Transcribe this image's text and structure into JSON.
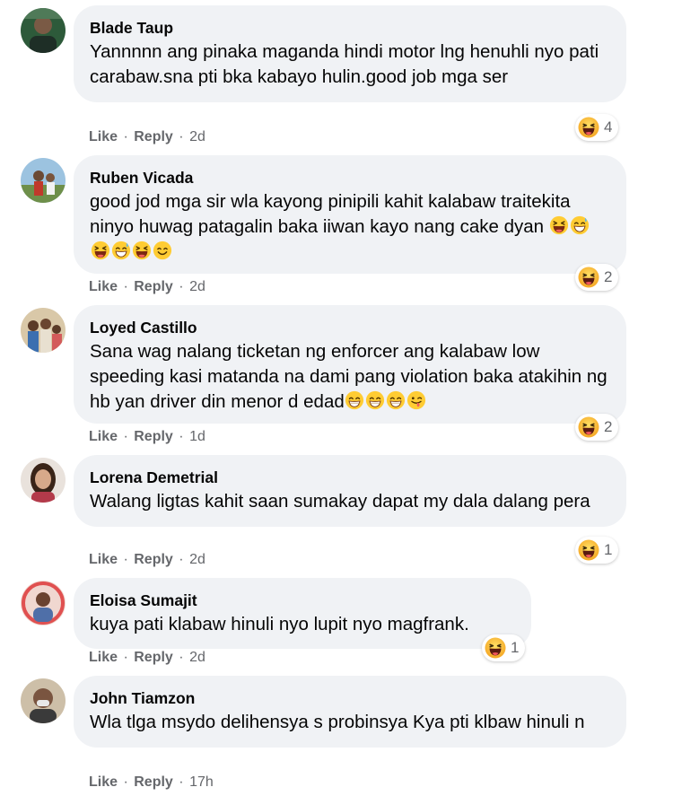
{
  "comments": [
    {
      "author": "Blade Taup",
      "text": "Yannnnn ang pinaka maganda hindi motor lng henuhli nyo pati carabaw.sna pti bka kabayo hulin.good job mga ser",
      "reaction_icon": "haha-reaction-icon",
      "reaction_count": "4",
      "like": "Like",
      "reply": "Reply",
      "sep": "·",
      "time": "2d"
    },
    {
      "author": "Ruben Vicada",
      "text": "good jod mga sir wla kayong pinipili kahit kalabaw traitekita ninyo huwag patagalin baka iiwan kayo nang cake dyan",
      "emojis": [
        "squint-laugh-emoji",
        "grin-sweat-emoji",
        "squint-laugh-emoji",
        "grin-sweat-emoji",
        "squint-laugh-emoji",
        "smile-emoji"
      ],
      "reaction_icon": "haha-reaction-icon",
      "reaction_count": "2",
      "like": "Like",
      "reply": "Reply",
      "sep": "·",
      "time": "2d"
    },
    {
      "author": "Loyed Castillo",
      "text": "Sana wag nalang ticketan ng enforcer ang kalabaw low speeding kasi matanda na dami pang violation baka atakihin ng hb yan driver din menor d edad",
      "emojis": [
        "grin-emoji",
        "grin-emoji",
        "grin-emoji",
        "wink-tongue-emoji"
      ],
      "reaction_icon": "haha-reaction-icon",
      "reaction_count": "2",
      "like": "Like",
      "reply": "Reply",
      "sep": "·",
      "time": "1d"
    },
    {
      "author": "Lorena Demetrial",
      "text": "Walang ligtas kahit saan sumakay dapat my dala dalang pera",
      "reaction_icon": "haha-reaction-icon",
      "reaction_count": "1",
      "like": "Like",
      "reply": "Reply",
      "sep": "·",
      "time": "2d"
    },
    {
      "author": "Eloisa Sumajit",
      "text": "kuya pati klabaw hinuli nyo lupit nyo magfrank.",
      "reaction_icon": "haha-reaction-icon",
      "reaction_count": "1",
      "like": "Like",
      "reply": "Reply",
      "sep": "·",
      "time": "2d"
    },
    {
      "author": "John Tiamzon",
      "text": "Wla tlga msydo delihensya s probinsya Kya pti klbaw hinuli n",
      "like": "Like",
      "reply": "Reply",
      "sep": "·",
      "time": "17h"
    }
  ],
  "colors": {
    "bubble": "#f0f2f5",
    "name": "#050505",
    "meta": "#65676b",
    "reaction_yellow": "#f7b125"
  }
}
